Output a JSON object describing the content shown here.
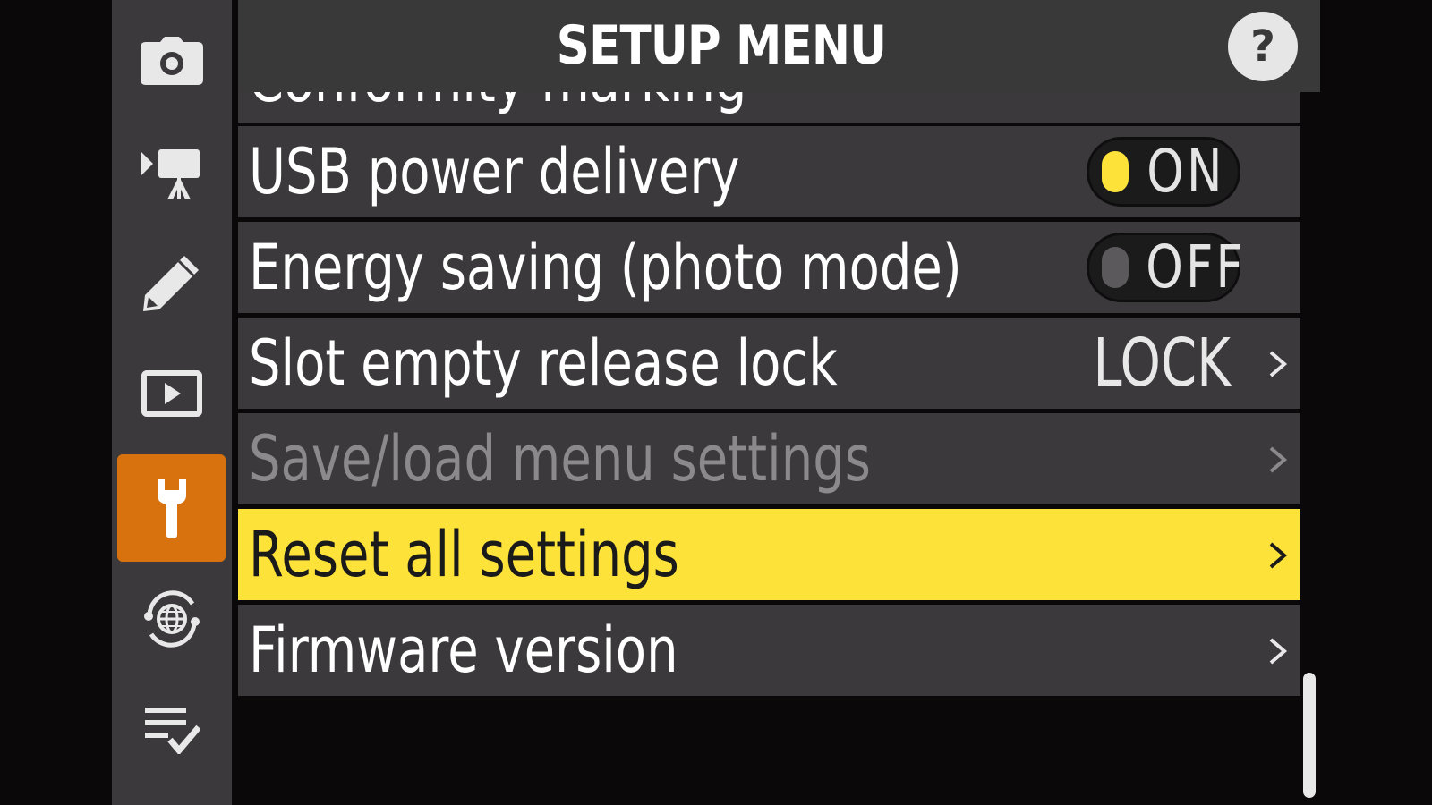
{
  "header": {
    "title": "SETUP MENU",
    "help_label": "?"
  },
  "sidebar": {
    "items": [
      {
        "icon": "camera-icon",
        "active": false
      },
      {
        "icon": "movie-camera-icon",
        "active": false
      },
      {
        "icon": "pencil-icon",
        "active": false
      },
      {
        "icon": "playback-icon",
        "active": false
      },
      {
        "icon": "wrench-icon",
        "active": true
      },
      {
        "icon": "network-globe-icon",
        "active": false
      },
      {
        "icon": "my-menu-checklist-icon",
        "active": false
      }
    ]
  },
  "menu": {
    "partial_item": "Conformity marking",
    "items": [
      {
        "label": "USB power delivery",
        "toggle": "ON",
        "state": "on"
      },
      {
        "label": "Energy saving (photo mode)",
        "toggle": "OFF",
        "state": "off"
      },
      {
        "label": "Slot empty release lock",
        "value": "LOCK"
      },
      {
        "label": "Save/load menu settings",
        "disabled": true
      },
      {
        "label": "Reset all settings",
        "selected": true
      },
      {
        "label": "Firmware version"
      }
    ]
  },
  "colors": {
    "background": "#0b080a",
    "panel": "#3b393b",
    "accent_active_tab": "#d8720e",
    "highlight": "#fde23a",
    "disabled_text": "#8b898b"
  },
  "scroll": {
    "position": 1.0
  }
}
